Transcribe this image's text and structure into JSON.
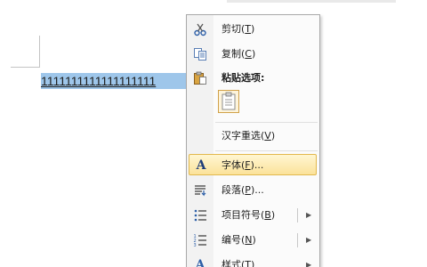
{
  "document": {
    "selected_text": "1111111111111111111"
  },
  "context_menu": {
    "items": [
      {
        "key": "cut",
        "label_main": "剪切(",
        "label_key": "T",
        "label_end": ")",
        "icon": "scissors-icon"
      },
      {
        "key": "copy",
        "label_main": "复制(",
        "label_key": "C",
        "label_end": ")",
        "icon": "copy-icon"
      },
      {
        "key": "paste_header",
        "label_main": "粘贴选项:",
        "icon": "clipboard-icon"
      },
      {
        "key": "paste_keep",
        "icon": "paste-keep-text-icon"
      },
      {
        "key": "hanzi",
        "label_main": "汉字重选(",
        "label_key": "V",
        "label_end": ")"
      },
      {
        "key": "font",
        "label_main": "字体(",
        "label_key": "F",
        "label_end": ")...",
        "icon": "font-icon"
      },
      {
        "key": "paragraph",
        "label_main": "段落(",
        "label_key": "P",
        "label_end": ")...",
        "icon": "paragraph-icon"
      },
      {
        "key": "bullets",
        "label_main": "项目符号(",
        "label_key": "B",
        "label_end": ")",
        "icon": "bullets-icon",
        "arrow": "▶"
      },
      {
        "key": "numbering",
        "label_main": "编号(",
        "label_key": "N",
        "label_end": ")",
        "icon": "numbering-icon",
        "arrow": "▶"
      },
      {
        "key": "styles",
        "label_main": "样式(",
        "label_key": "T",
        "label_end": ")",
        "icon": "styles-icon",
        "arrow": "▶"
      }
    ]
  },
  "colors": {
    "selection": "#9ec6ea",
    "highlight_border": "#e2b84c",
    "highlight_fill": "#fbe29a"
  }
}
